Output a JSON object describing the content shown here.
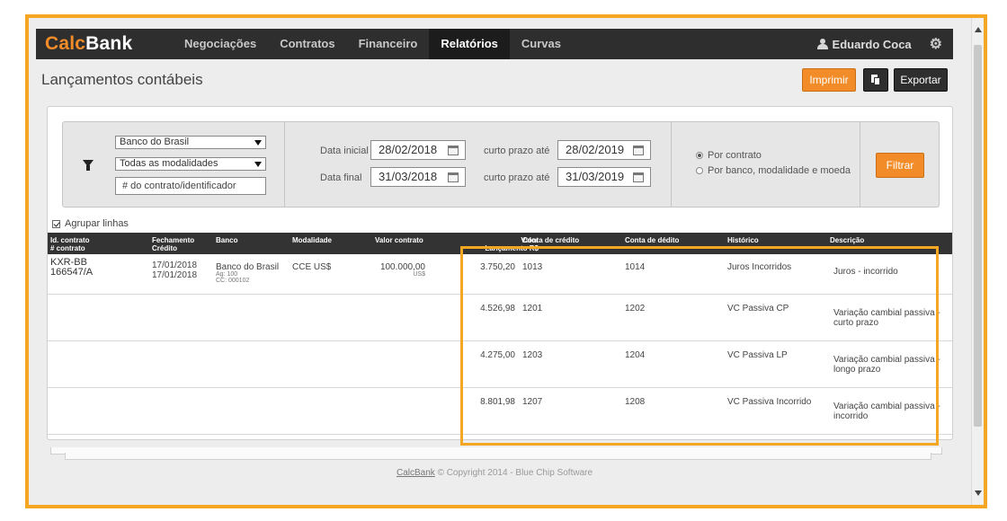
{
  "brand": {
    "calc": "Calc",
    "bank": "Bank"
  },
  "nav": {
    "items": [
      {
        "label": "Negociações",
        "active": false
      },
      {
        "label": "Contratos",
        "active": false
      },
      {
        "label": "Financeiro",
        "active": false
      },
      {
        "label": "Relatórios",
        "active": true
      },
      {
        "label": "Curvas",
        "active": false
      }
    ],
    "user": "Eduardo Coca",
    "user_icon": "user-icon",
    "settings_icon": "gear-icon"
  },
  "page": {
    "title": "Lançamentos contábeis",
    "print_label": "Imprimir",
    "copy_icon": "copy-icon",
    "export_label": "Exportar"
  },
  "filters": {
    "filter_icon": "funnel-icon",
    "bank_select": "Banco do Brasil",
    "modality_select": "Todas as modalidades",
    "contract_placeholder": "# do contrato/identificador",
    "start_label": "Data inicial",
    "start_date": "28/02/2018",
    "end_label": "Data final",
    "end_date": "31/03/2018",
    "short_term_label_1": "curto prazo até",
    "short_term_date_1": "28/02/2019",
    "short_term_label_2": "curto prazo até",
    "short_term_date_2": "31/03/2019",
    "radio_by_contract": "Por contrato",
    "radio_by_bank": "Por banco, modalidade e moeda",
    "filter_button": "Filtrar",
    "group_rows_label": "Agrupar linhas",
    "group_rows_checked": true
  },
  "table": {
    "headers": {
      "id_1": "Id. contrato",
      "id_2": "# contrato",
      "fechamento_1": "Fechamento",
      "fechamento_2": "Crédito",
      "banco": "Banco",
      "modalidade": "Modalidade",
      "valor_contrato": "Valor contrato",
      "valor_1": "Valor",
      "valor_2": "Lançamento R$",
      "conta_credito": "Conta de crédito",
      "conta_debito": "Conta de dédito",
      "historico": "Histórico",
      "descricao": "Descrição"
    },
    "contract": {
      "id_1": "KXR-BB",
      "id_2": "166547/A",
      "fechamento": "17/01/2018",
      "credito": "17/01/2018",
      "banco": "Banco do Brasil",
      "ag": "Ag: 100",
      "cc": "CC: 000102",
      "modalidade": "CCE US$",
      "valor": "100.000,00",
      "moeda": "US$"
    },
    "entries": [
      {
        "valor": "3.750,20",
        "credito": "1013",
        "debito": "1014",
        "historico": "Juros Incorridos",
        "descricao_1": "Juros - incorrido",
        "descricao_2": ""
      },
      {
        "valor": "4.526,98",
        "credito": "1201",
        "debito": "1202",
        "historico": "VC Passiva CP",
        "descricao_1": "Variação cambial passiva -",
        "descricao_2": "curto prazo"
      },
      {
        "valor": "4.275,00",
        "credito": "1203",
        "debito": "1204",
        "historico": "VC Passiva LP",
        "descricao_1": "Variação cambial passiva -",
        "descricao_2": "longo prazo"
      },
      {
        "valor": "8.801,98",
        "credito": "1207",
        "debito": "1208",
        "historico": "VC Passiva Incorrido",
        "descricao_1": "Variação cambial passiva -",
        "descricao_2": "incorrido"
      }
    ]
  },
  "footer": {
    "link": "CalcBank",
    "copyright": "© Copyright 2014 - Blue Chip Software"
  },
  "colors": {
    "accent": "#f28c28",
    "navbar": "#2e2e2e",
    "highlight": "#f5a623"
  }
}
